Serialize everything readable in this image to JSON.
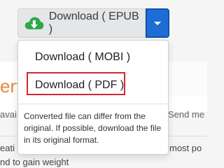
{
  "download_button": {
    "label": "Download ( EPUB )",
    "icon": "cloud-download-icon",
    "icon_color": "#2ea84a"
  },
  "toggle": {
    "icon": "caret-down-icon",
    "color": "#1e6dd6"
  },
  "menu": {
    "items": [
      {
        "label": "Download ( MOBI )"
      },
      {
        "label": "Download ( PDF )",
        "highlighted": true,
        "highlight_color": "#d7262e"
      }
    ],
    "note": "Converted file can differ from the original. If possible, download the file in its original format."
  },
  "background": {
    "heading_fragment": "ert",
    "left_fragment": "avai",
    "right_fragment": "Send me",
    "line2_left": "eati",
    "line2_right": "most po",
    "line3": "nd to gain weight"
  }
}
